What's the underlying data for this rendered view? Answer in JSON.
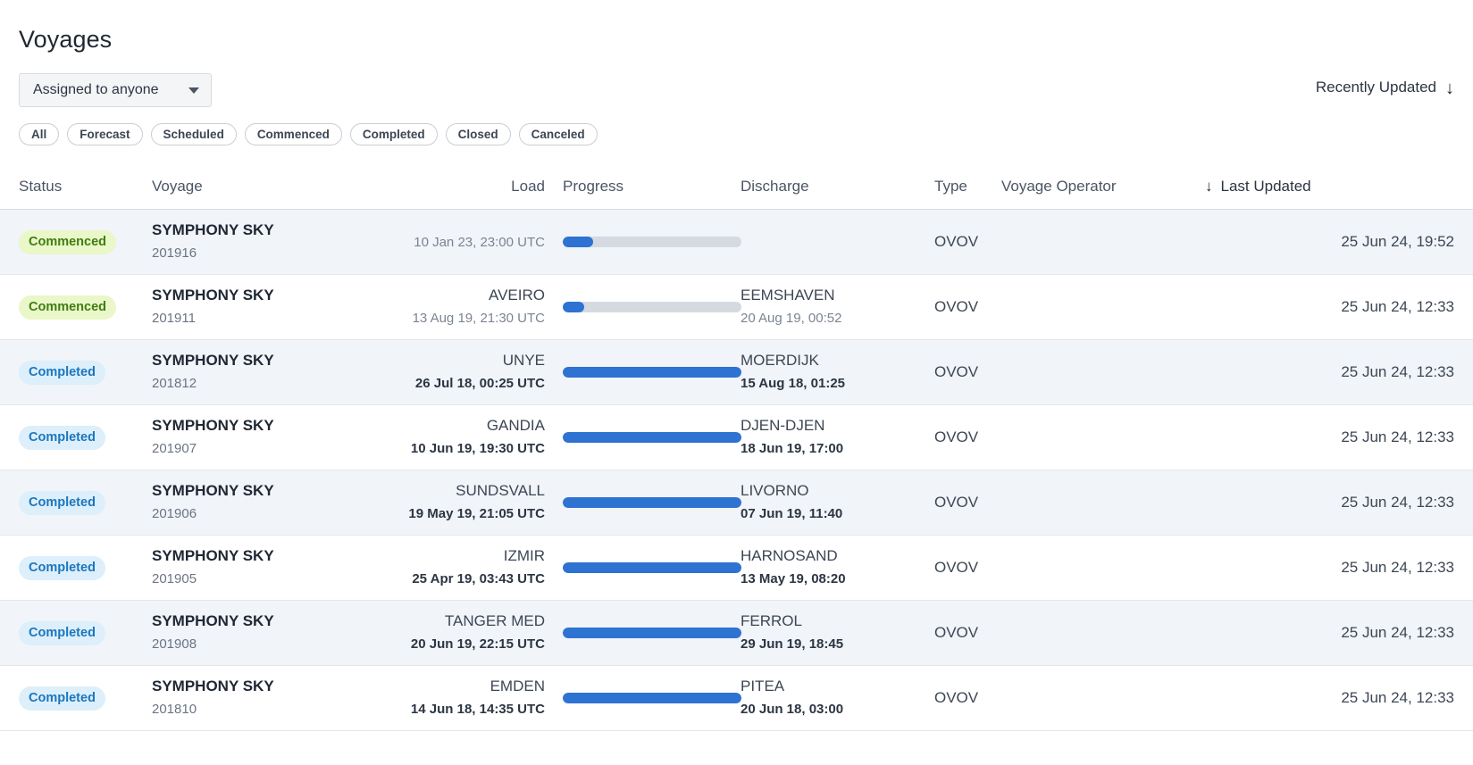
{
  "header": {
    "title": "Voyages"
  },
  "toolbar": {
    "assigned_filter_label": "Assigned to anyone",
    "assigned_filter_icon": "chevron-down-icon",
    "sort_label": "Recently Updated",
    "sort_icon": "arrow-down-icon"
  },
  "filter_pills": [
    {
      "label": "All"
    },
    {
      "label": "Forecast"
    },
    {
      "label": "Scheduled"
    },
    {
      "label": "Commenced"
    },
    {
      "label": "Completed"
    },
    {
      "label": "Closed"
    },
    {
      "label": "Canceled"
    }
  ],
  "table": {
    "columns": {
      "status": "Status",
      "voyage": "Voyage",
      "load": "Load",
      "progress": "Progress",
      "discharge": "Discharge",
      "type": "Type",
      "operator": "Voyage Operator",
      "updated": "Last Updated",
      "sort_icon": "arrow-down-icon"
    },
    "rows": [
      {
        "status": "Commenced",
        "status_kind": "commenced",
        "vessel": "SYMPHONY SKY",
        "voyage_no": "201916",
        "load_port": "",
        "load_time": "10 Jan 23, 23:00 UTC",
        "load_time_bold": false,
        "progress_percent": 17,
        "discharge_port": "",
        "discharge_time": "",
        "discharge_time_bold": false,
        "type": "OVOV",
        "operator": "",
        "updated": "25 Jun 24, 19:52"
      },
      {
        "status": "Commenced",
        "status_kind": "commenced",
        "vessel": "SYMPHONY SKY",
        "voyage_no": "201911",
        "load_port": "AVEIRO",
        "load_time": "13 Aug 19, 21:30 UTC",
        "load_time_bold": false,
        "progress_percent": 12,
        "discharge_port": "EEMSHAVEN",
        "discharge_time": "20 Aug 19, 00:52",
        "discharge_time_bold": false,
        "type": "OVOV",
        "operator": "",
        "updated": "25 Jun 24, 12:33"
      },
      {
        "status": "Completed",
        "status_kind": "completed",
        "vessel": "SYMPHONY SKY",
        "voyage_no": "201812",
        "load_port": "UNYE",
        "load_time": "26 Jul 18, 00:25 UTC",
        "load_time_bold": true,
        "progress_percent": 100,
        "discharge_port": "MOERDIJK",
        "discharge_time": "15 Aug 18, 01:25",
        "discharge_time_bold": true,
        "type": "OVOV",
        "operator": "",
        "updated": "25 Jun 24, 12:33"
      },
      {
        "status": "Completed",
        "status_kind": "completed",
        "vessel": "SYMPHONY SKY",
        "voyage_no": "201907",
        "load_port": "GANDIA",
        "load_time": "10 Jun 19, 19:30 UTC",
        "load_time_bold": true,
        "progress_percent": 100,
        "discharge_port": "DJEN-DJEN",
        "discharge_time": "18 Jun 19, 17:00",
        "discharge_time_bold": true,
        "type": "OVOV",
        "operator": "",
        "updated": "25 Jun 24, 12:33"
      },
      {
        "status": "Completed",
        "status_kind": "completed",
        "vessel": "SYMPHONY SKY",
        "voyage_no": "201906",
        "load_port": "SUNDSVALL",
        "load_time": "19 May 19, 21:05 UTC",
        "load_time_bold": true,
        "progress_percent": 100,
        "discharge_port": "LIVORNO",
        "discharge_time": "07 Jun 19, 11:40",
        "discharge_time_bold": true,
        "type": "OVOV",
        "operator": "",
        "updated": "25 Jun 24, 12:33"
      },
      {
        "status": "Completed",
        "status_kind": "completed",
        "vessel": "SYMPHONY SKY",
        "voyage_no": "201905",
        "load_port": "IZMIR",
        "load_time": "25 Apr 19, 03:43 UTC",
        "load_time_bold": true,
        "progress_percent": 100,
        "discharge_port": "HARNOSAND",
        "discharge_time": "13 May 19, 08:20",
        "discharge_time_bold": true,
        "type": "OVOV",
        "operator": "",
        "updated": "25 Jun 24, 12:33"
      },
      {
        "status": "Completed",
        "status_kind": "completed",
        "vessel": "SYMPHONY SKY",
        "voyage_no": "201908",
        "load_port": "TANGER MED",
        "load_time": "20 Jun 19, 22:15 UTC",
        "load_time_bold": true,
        "progress_percent": 100,
        "discharge_port": "FERROL",
        "discharge_time": "29 Jun 19, 18:45",
        "discharge_time_bold": true,
        "type": "OVOV",
        "operator": "",
        "updated": "25 Jun 24, 12:33"
      },
      {
        "status": "Completed",
        "status_kind": "completed",
        "vessel": "SYMPHONY SKY",
        "voyage_no": "201810",
        "load_port": "EMDEN",
        "load_time": "14 Jun 18, 14:35 UTC",
        "load_time_bold": true,
        "progress_percent": 100,
        "discharge_port": "PITEA",
        "discharge_time": "20 Jun 18, 03:00",
        "discharge_time_bold": true,
        "type": "OVOV",
        "operator": "",
        "updated": "25 Jun 24, 12:33"
      }
    ]
  },
  "colors": {
    "accent_blue": "#2e72d2",
    "badge_commenced_bg": "#eaf7c8",
    "badge_commenced_fg": "#3f7d11",
    "badge_completed_bg": "#dceffb",
    "badge_completed_fg": "#1c76bd",
    "row_alt_bg": "#f1f4f8",
    "progress_track": "#d5dae1"
  }
}
